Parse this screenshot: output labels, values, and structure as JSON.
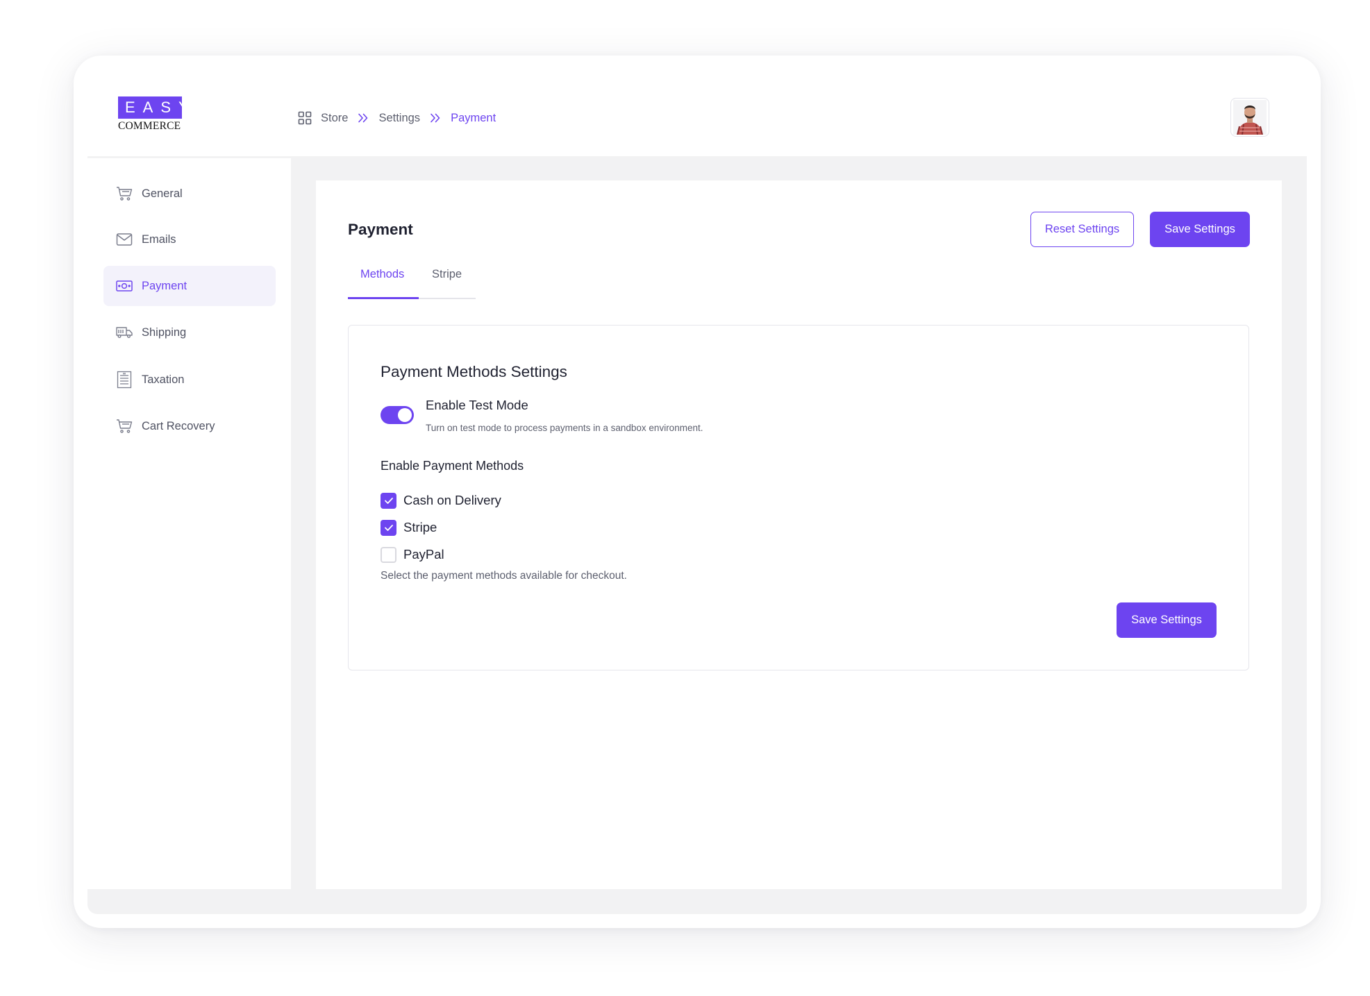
{
  "brand": {
    "logo_top": "EASY",
    "logo_bottom": "COMMERCE",
    "accent": "#6d44f0"
  },
  "breadcrumb": {
    "icon": "grid-icon",
    "items": [
      "Store",
      "Settings",
      "Payment"
    ]
  },
  "sidebar": {
    "items": [
      {
        "label": "General",
        "icon": "cart-icon",
        "active": false
      },
      {
        "label": "Emails",
        "icon": "envelope-icon",
        "active": false
      },
      {
        "label": "Payment",
        "icon": "banknote-icon",
        "active": true
      },
      {
        "label": "Shipping",
        "icon": "truck-icon",
        "active": false
      },
      {
        "label": "Taxation",
        "icon": "receipt-icon",
        "active": false
      },
      {
        "label": "Cart Recovery",
        "icon": "cart-icon",
        "active": false
      }
    ]
  },
  "main": {
    "title": "Payment",
    "reset_label": "Reset Settings",
    "save_label": "Save Settings",
    "tabs": [
      {
        "label": "Methods",
        "active": true
      },
      {
        "label": "Stripe",
        "active": false
      }
    ]
  },
  "card": {
    "title": "Payment Methods Settings",
    "test_mode": {
      "label": "Enable Test Mode",
      "description": "Turn on test mode to process payments in a sandbox environment.",
      "enabled": true
    },
    "methods_label": "Enable Payment Methods",
    "methods": [
      {
        "label": "Cash on Delivery",
        "checked": true
      },
      {
        "label": "Stripe",
        "checked": true
      },
      {
        "label": "PayPal",
        "checked": false
      }
    ],
    "help": "Select the payment methods available for checkout.",
    "save_label": "Save Settings"
  }
}
